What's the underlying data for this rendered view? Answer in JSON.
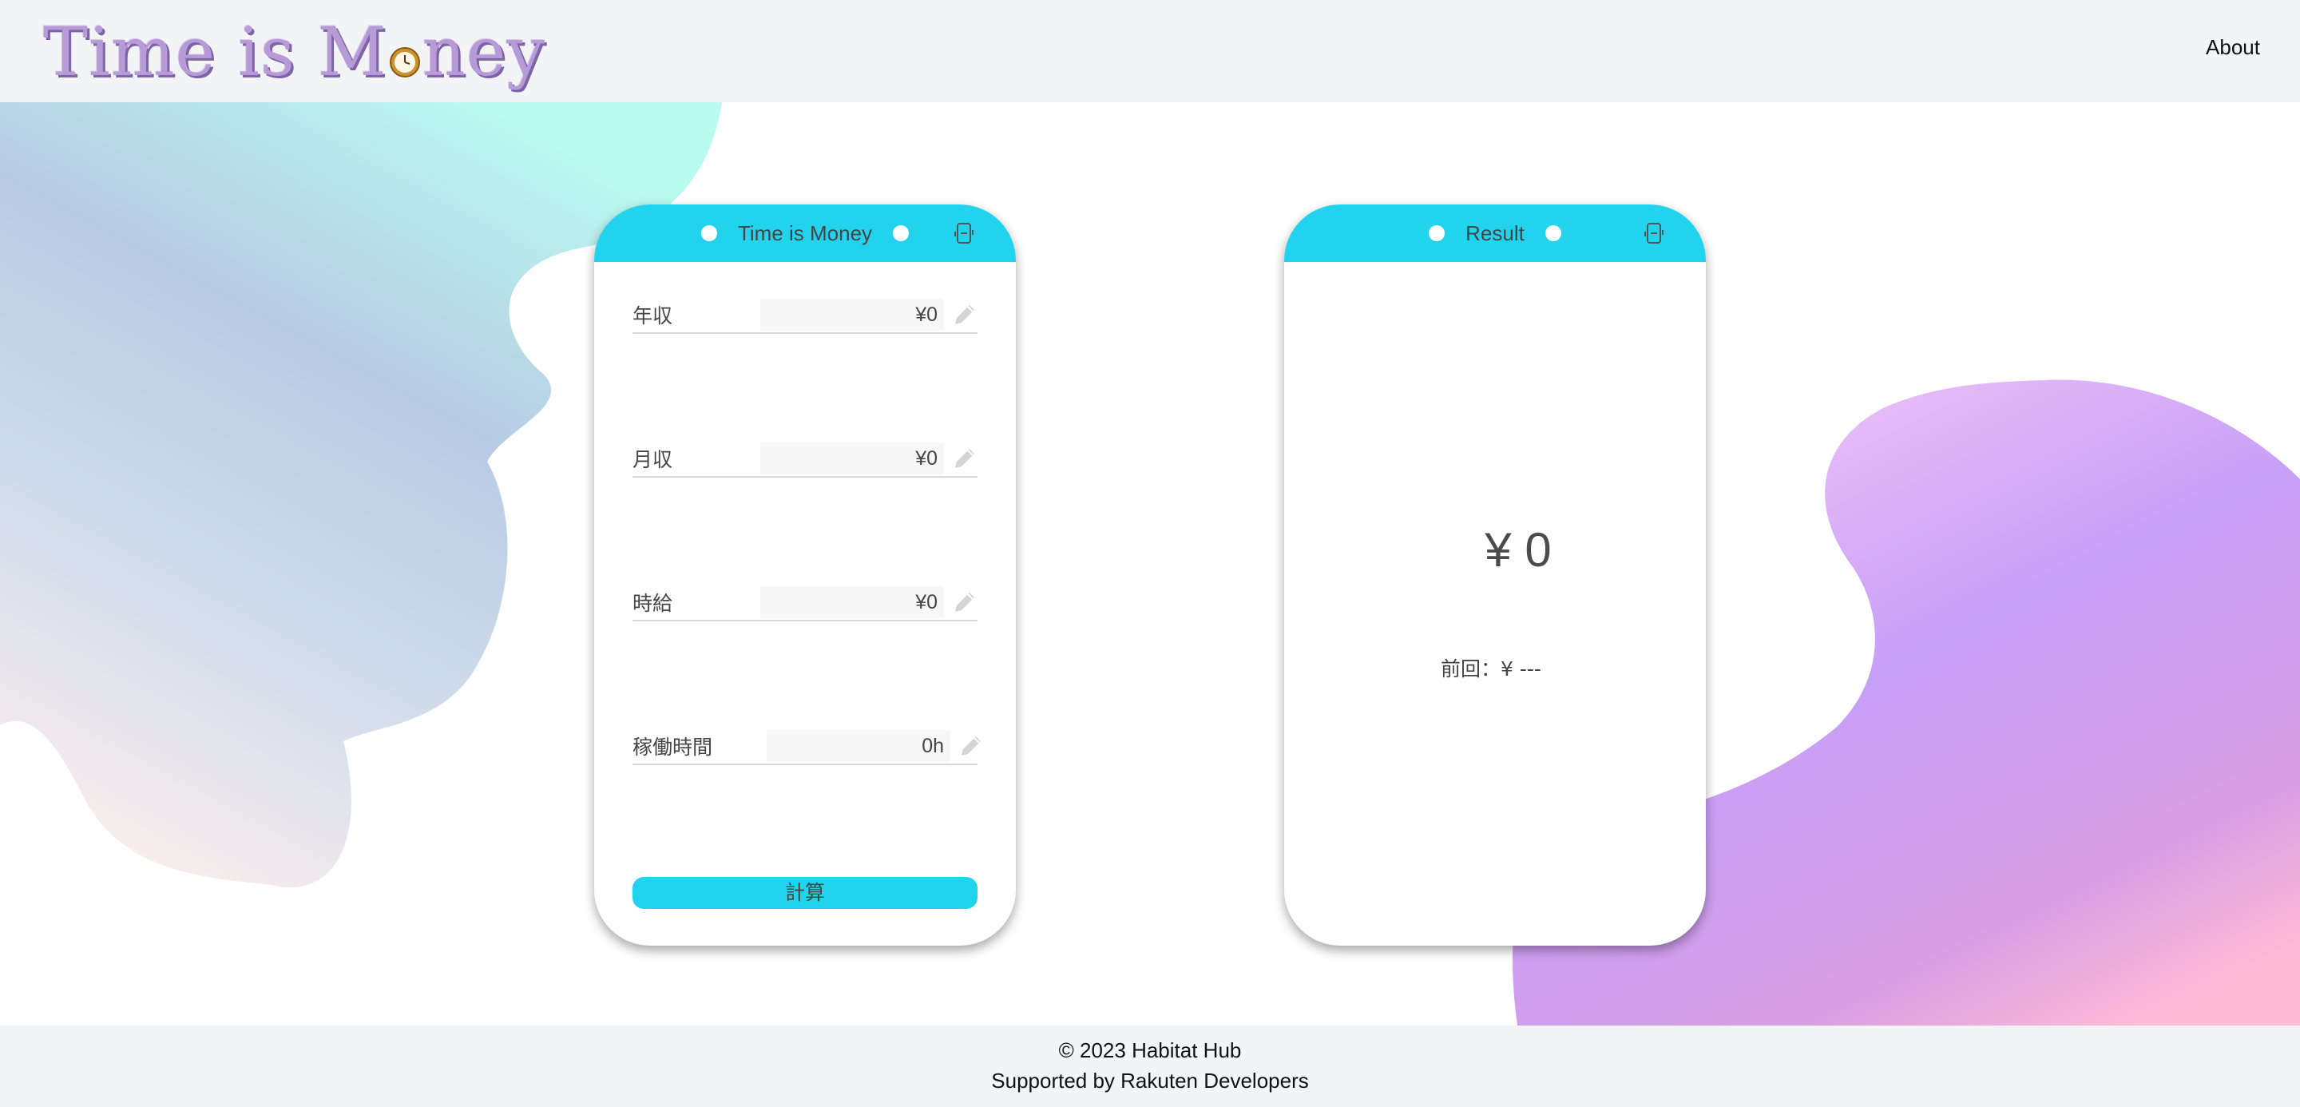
{
  "header": {
    "logo_text_before": "Time is M",
    "logo_text_after": "ney",
    "logo_icon": "clock-icon",
    "about_label": "About"
  },
  "calculator": {
    "title": "Time is Money",
    "fields": [
      {
        "label": "年収",
        "value": "¥0"
      },
      {
        "label": "月収",
        "value": "¥0"
      },
      {
        "label": "時給",
        "value": "¥0"
      },
      {
        "label": "稼働時間",
        "value": "0h"
      }
    ],
    "calc_button_label": "計算"
  },
  "result": {
    "title": "Result",
    "value": "¥ 0",
    "previous": "前回：¥ ---"
  },
  "footer": {
    "copyright": "© 2023 Habitat Hub",
    "supported": "Supported by Rakuten Developers"
  },
  "colors": {
    "accent": "#22d3ee",
    "logo": "#b69bd6",
    "header_bg": "#f3f4f6"
  }
}
